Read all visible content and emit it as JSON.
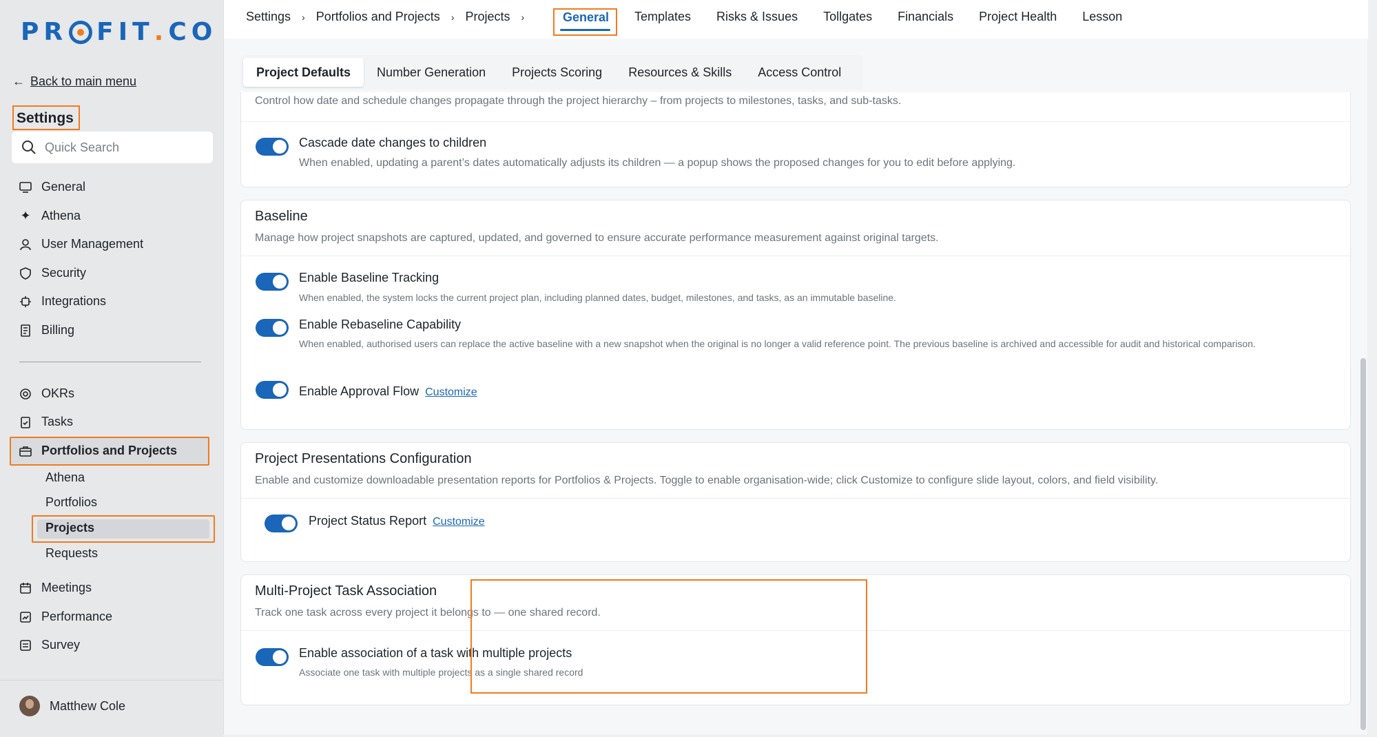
{
  "brand": {
    "logo_text_pre": "PR",
    "logo_text_post": "FIT",
    "logo_dot": ".",
    "logo_suffix": "CO"
  },
  "sidebar": {
    "back_label": "Back to main menu",
    "settings_title": "Settings",
    "search_placeholder": "Quick Search",
    "items": [
      {
        "label": "General",
        "icon": "monitor-icon"
      },
      {
        "label": "Athena",
        "icon": "sparkle-icon"
      },
      {
        "label": "User Management",
        "icon": "user-icon"
      },
      {
        "label": "Security",
        "icon": "shield-icon"
      },
      {
        "label": "Integrations",
        "icon": "chip-icon"
      },
      {
        "label": "Billing",
        "icon": "receipt-icon"
      }
    ],
    "modules": [
      {
        "label": "OKRs",
        "icon": "target-icon"
      },
      {
        "label": "Tasks",
        "icon": "clipboard-check-icon"
      },
      {
        "label": "Portfolios and Projects",
        "icon": "briefcase-icon"
      }
    ],
    "sub_items": [
      "Athena",
      "Portfolios",
      "Projects",
      "Requests"
    ],
    "bottom_items": [
      {
        "label": "Meetings",
        "icon": "calendar-icon"
      },
      {
        "label": "Performance",
        "icon": "chart-icon"
      },
      {
        "label": "Survey",
        "icon": "survey-icon"
      }
    ],
    "user_name": "Matthew Cole"
  },
  "breadcrumb": [
    "Settings",
    "Portfolios and Projects",
    "Projects"
  ],
  "top_tabs": {
    "active": "General",
    "others": [
      "Templates",
      "Risks & Issues",
      "Tollgates",
      "Financials",
      "Project Health",
      "Lesson"
    ]
  },
  "sub_tabs": [
    "Project Defaults",
    "Number Generation",
    "Projects Scoring",
    "Resources & Skills",
    "Access Control"
  ],
  "cards": {
    "dates": {
      "desc": "Control how date and schedule changes propagate through the project hierarchy – from projects to milestones, tasks, and sub-tasks.",
      "option_label": "Cascade date changes to children",
      "option_desc": "When enabled, updating a parent’s dates automatically adjusts its children — a popup shows the proposed changes for you to edit before applying."
    },
    "baseline": {
      "title": "Baseline",
      "desc": "Manage how project snapshots are captured, updated, and governed to ensure accurate performance measurement against original targets.",
      "opt1_label": "Enable Baseline Tracking",
      "opt1_desc": "When enabled, the system locks the current project plan, including planned dates, budget, milestones, and tasks, as an immutable baseline.",
      "opt2_label": "Enable Rebaseline Capability",
      "opt2_desc": "When enabled, authorised users can replace the active baseline with a new snapshot when the original is no longer a valid reference point. The previous baseline is archived and accessible for audit and historical comparison.",
      "opt3_label": "Enable Approval Flow",
      "customize": "Customize"
    },
    "presentations": {
      "title": "Project Presentations Configuration",
      "desc": "Enable and customize downloadable presentation reports for Portfolios & Projects. Toggle to enable organisation-wide; click Customize to configure slide layout, colors, and field visibility.",
      "opt_label": "Project Status Report",
      "customize": "Customize"
    },
    "multi": {
      "title": "Multi-Project Task Association",
      "desc": "Track one task across every project it belongs to — one shared record.",
      "opt_label": "Enable association of a task with multiple projects",
      "opt_desc": "Associate one task with multiple projects as a single shared record"
    }
  },
  "colors": {
    "accent": "#1a66b8",
    "highlight": "#f07b1f"
  }
}
